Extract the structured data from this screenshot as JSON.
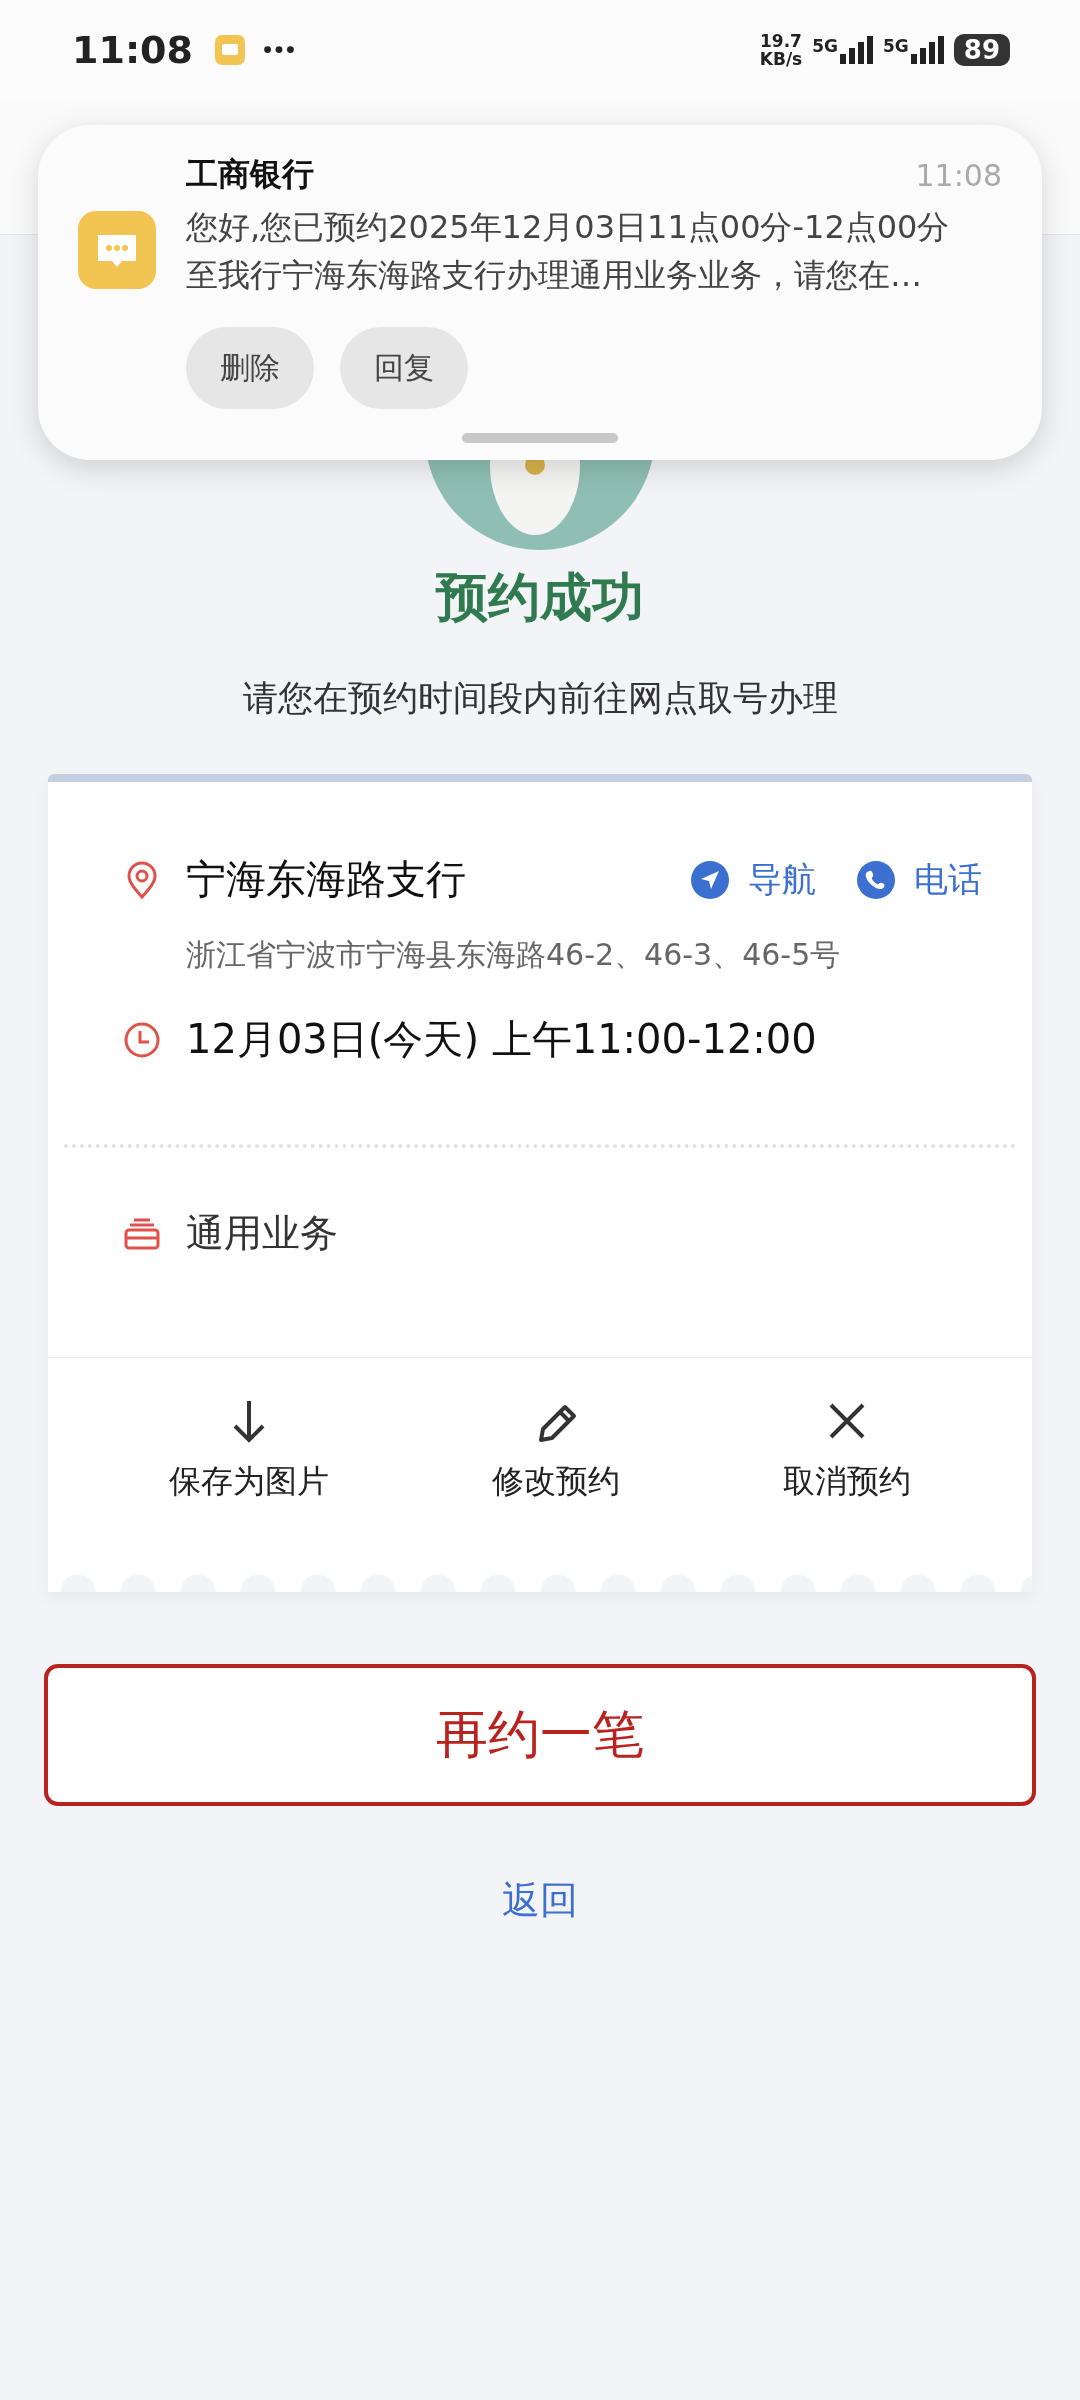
{
  "status_bar": {
    "time": "11:08",
    "speed": "19.7",
    "speed_unit": "KB/s",
    "networks": [
      "5G",
      "5G"
    ],
    "battery": "89"
  },
  "notification": {
    "app": "工商银行",
    "time": "11:08",
    "message": "您好,您已预约2025年12月03日11点00分-12点00分至我行宁海东海路支行办理通用业务业务，请您在…",
    "actions": [
      "删除",
      "回复"
    ]
  },
  "result": {
    "title": "预约成功",
    "subtitle": "请您在预约时间段内前往网点取号办理"
  },
  "appointment": {
    "branch": "宁海东海路支行",
    "links": [
      {
        "kind": "navigate",
        "label": "导航"
      },
      {
        "kind": "phone",
        "label": "电话"
      }
    ],
    "address": "浙江省宁波市宁海县东海路46-2、46-3、46-5号",
    "time": "12月03日(今天) 上午11:00-12:00",
    "service": "通用业务",
    "actions": [
      {
        "kind": "save",
        "label": "保存为图片"
      },
      {
        "kind": "edit",
        "label": "修改预约"
      },
      {
        "kind": "cancel",
        "label": "取消预约"
      }
    ]
  },
  "primary_button": "再约一笔",
  "back_link": "返回"
}
